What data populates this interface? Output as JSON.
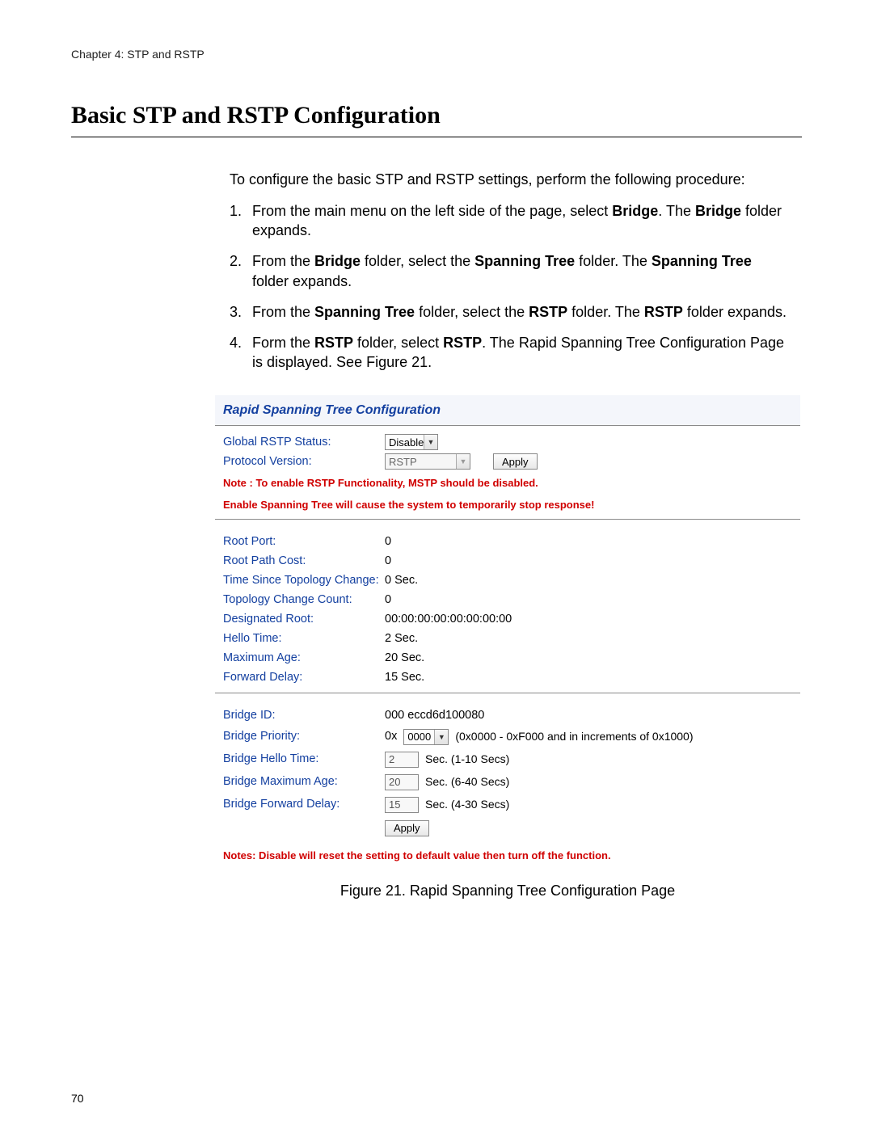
{
  "chapter": "Chapter 4: STP and RSTP",
  "heading": "Basic STP and RSTP Configuration",
  "intro": "To configure the basic STP and RSTP settings, perform the following procedure:",
  "steps": [
    {
      "num": "1.",
      "pre": "From the main menu on the left side of the page, select ",
      "b1": "Bridge",
      "post": ". The ",
      "b2": "Bridge",
      "post2": " folder expands."
    },
    {
      "num": "2.",
      "pre": "From the ",
      "b1": "Bridge",
      "mid": " folder, select the ",
      "b2": "Spanning Tree",
      "post": " folder. The ",
      "b3": "Spanning Tree",
      "post2": " folder expands."
    },
    {
      "num": "3.",
      "pre": "From the ",
      "b1": "Spanning Tree",
      "mid": " folder, select the ",
      "b2": "RSTP",
      "post": " folder. The ",
      "b3": "RSTP",
      "post2": " folder expands."
    },
    {
      "num": "4.",
      "pre": "Form the ",
      "b1": "RSTP",
      "mid": " folder, select ",
      "b2": "RSTP",
      "post": ". The Rapid Spanning Tree Configuration Page is displayed. See Figure 21."
    }
  ],
  "figure": {
    "title": "Rapid Spanning Tree Configuration",
    "top": {
      "global_status_label": "Global RSTP Status:",
      "global_status_value": "Disable",
      "protocol_label": "Protocol Version:",
      "protocol_value": "RSTP",
      "apply_label": "Apply"
    },
    "note1": "Note : To enable RSTP Functionality, MSTP should be disabled.",
    "note2": "Enable Spanning Tree will cause the system to temporarily stop response!",
    "stats": [
      {
        "label": "Root Port:",
        "value": "0"
      },
      {
        "label": "Root Path Cost:",
        "value": "0"
      },
      {
        "label": "Time Since Topology Change:",
        "value": "0  Sec."
      },
      {
        "label": "Topology Change Count:",
        "value": "0"
      },
      {
        "label": "Designated Root:",
        "value": "00:00:00:00:00:00:00:00"
      },
      {
        "label": "Hello Time:",
        "value": "2  Sec."
      },
      {
        "label": "Maximum Age:",
        "value": "20  Sec."
      },
      {
        "label": "Forward Delay:",
        "value": "15  Sec."
      }
    ],
    "bridge": {
      "id_label": "Bridge ID:",
      "id_value": "000 eccd6d100080",
      "priority_label": "Bridge Priority:",
      "priority_prefix": "0x",
      "priority_value": "0000",
      "priority_hint": "(0x0000 - 0xF000 and in increments of 0x1000)",
      "hello_label": "Bridge Hello Time:",
      "hello_value": "2",
      "hello_hint": "Sec. (1-10 Secs)",
      "maxage_label": "Bridge Maximum Age:",
      "maxage_value": "20",
      "maxage_hint": "Sec. (6-40 Secs)",
      "fwd_label": "Bridge Forward Delay:",
      "fwd_value": "15",
      "fwd_hint": "Sec. (4-30 Secs)",
      "apply_label": "Apply"
    },
    "bottom_note": "Notes: Disable will reset the setting to default value then turn off the function.",
    "caption": "Figure 21. Rapid Spanning Tree Configuration Page"
  },
  "page_number": "70"
}
